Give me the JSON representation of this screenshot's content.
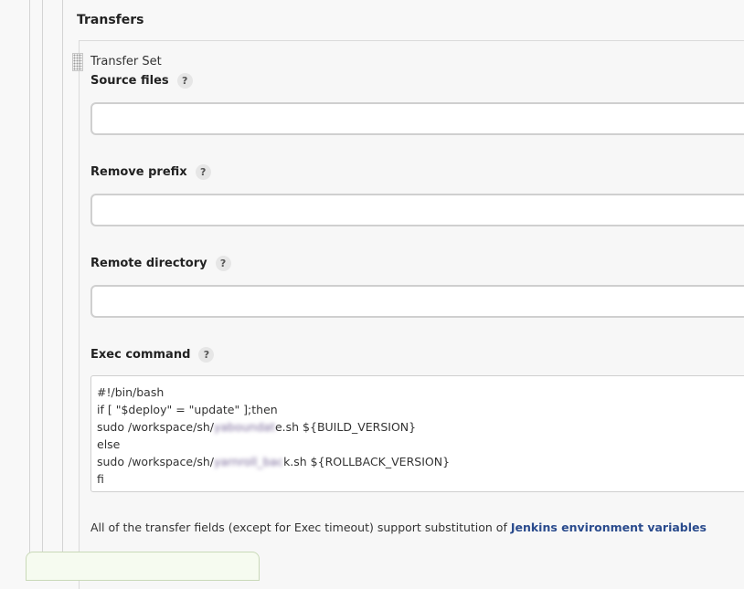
{
  "section": {
    "title": "Transfers"
  },
  "transfer_set": {
    "label": "Transfer Set"
  },
  "fields": {
    "source_files": {
      "label": "Source files",
      "help": "?",
      "value": ""
    },
    "remove_prefix": {
      "label": "Remove prefix",
      "help": "?",
      "value": ""
    },
    "remote_directory": {
      "label": "Remote directory",
      "help": "?",
      "value": ""
    },
    "exec_command": {
      "label": "Exec command",
      "help": "?",
      "lines": [
        "#!/bin/bash",
        "if [ \"$deploy\" = \"update\" ];then",
        "sudo /workspace/sh/",
        "else",
        "sudo /workspace/sh/",
        "fi"
      ],
      "line3_suffix": "e.sh ${BUILD_VERSION}",
      "line5_suffix": "k.sh ${ROLLBACK_VERSION}"
    }
  },
  "footer": {
    "text": "All of the transfer fields (except for Exec timeout) support substitution of ",
    "link": "Jenkins environment variables"
  }
}
